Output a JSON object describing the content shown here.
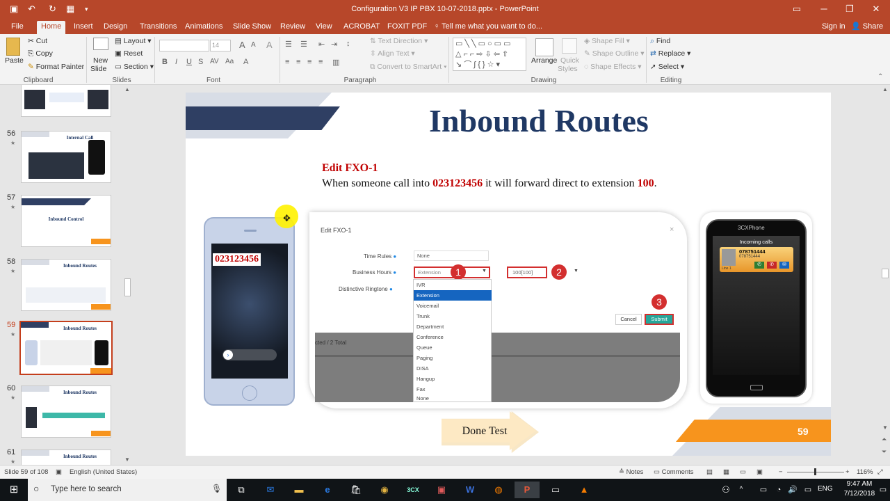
{
  "app": {
    "doc_title": "Configuration V3 IP PBX 10-07-2018.pptx - PowerPoint"
  },
  "ribbon_tabs": [
    "File",
    "Home",
    "Insert",
    "Design",
    "Transitions",
    "Animations",
    "Slide Show",
    "Review",
    "View",
    "ACROBAT",
    "FOXIT PDF"
  ],
  "tell_me": "Tell me what you want to do...",
  "signin": "Sign in",
  "share": "Share",
  "clipboard": {
    "paste": "Paste",
    "cut": "Cut",
    "copy": "Copy",
    "format_painter": "Format Painter",
    "label": "Clipboard"
  },
  "slides_group": {
    "new_slide": "New",
    "new_slide2": "Slide",
    "layout": "Layout",
    "reset": "Reset",
    "section": "Section",
    "label": "Slides"
  },
  "font_group": {
    "size": "14",
    "label": "Font"
  },
  "paragraph_group": {
    "text_direction": "Text Direction",
    "align_text": "Align Text",
    "convert": "Convert to SmartArt",
    "label": "Paragraph"
  },
  "drawing_group": {
    "arrange": "Arrange",
    "quick_styles": "Quick",
    "quick_styles2": "Styles",
    "shape_fill": "Shape Fill",
    "shape_outline": "Shape Outline",
    "shape_effects": "Shape Effects",
    "label": "Drawing"
  },
  "editing_group": {
    "find": "Find",
    "replace": "Replace",
    "select": "Select",
    "label": "Editing"
  },
  "thumbnails": [
    {
      "num": "56",
      "title": "Internal Call"
    },
    {
      "num": "57",
      "title": "Inbound Control"
    },
    {
      "num": "58",
      "title": "Inbound Routes"
    },
    {
      "num": "59",
      "title": "Inbound Routes"
    },
    {
      "num": "60",
      "title": "Inbound Routes"
    },
    {
      "num": "61",
      "title": "Inbound Routes"
    }
  ],
  "slide": {
    "title": "Inbound Routes",
    "edit_heading": "Edit FXO-1",
    "sentence_a": "When someone call into ",
    "number": "023123456",
    "sentence_b": " it will forward direct to extension ",
    "ext": "100",
    "period": ".",
    "phone_number": "023123456",
    "dialog": {
      "title": "Edit FXO-1",
      "time_rules_label": "Time Rules",
      "time_rules_value": "None",
      "business_hours_label": "Business Hours",
      "business_hours_value": "Extension",
      "distinctive_label": "Distinctive Ringtone",
      "ext_value": "100[100]",
      "cancel": "Cancel",
      "submit": "Submit",
      "table_text": "cted / 2 Total",
      "options": [
        "IVR",
        "Extension",
        "Voicemail",
        "Trunk",
        "Department",
        "Conference",
        "Queue",
        "Paging",
        "DISA",
        "Hangup",
        "Fax",
        "None"
      ]
    },
    "badges": [
      "1",
      "2",
      "3"
    ],
    "threecx_title": "3CXPhone",
    "incoming": "Incoming calls",
    "caller1": "078751444",
    "caller2": "078751444",
    "line": "Line 1",
    "done_test": "Done Test",
    "slide_number": "59"
  },
  "status": {
    "slide_of": "Slide 59 of 108",
    "language": "English (United States)",
    "notes": "Notes",
    "comments": "Comments",
    "zoom": "116%"
  },
  "taskbar": {
    "search": "Type here to search",
    "lang": "ENG",
    "time": "9:47 AM",
    "date": "7/12/2018"
  }
}
